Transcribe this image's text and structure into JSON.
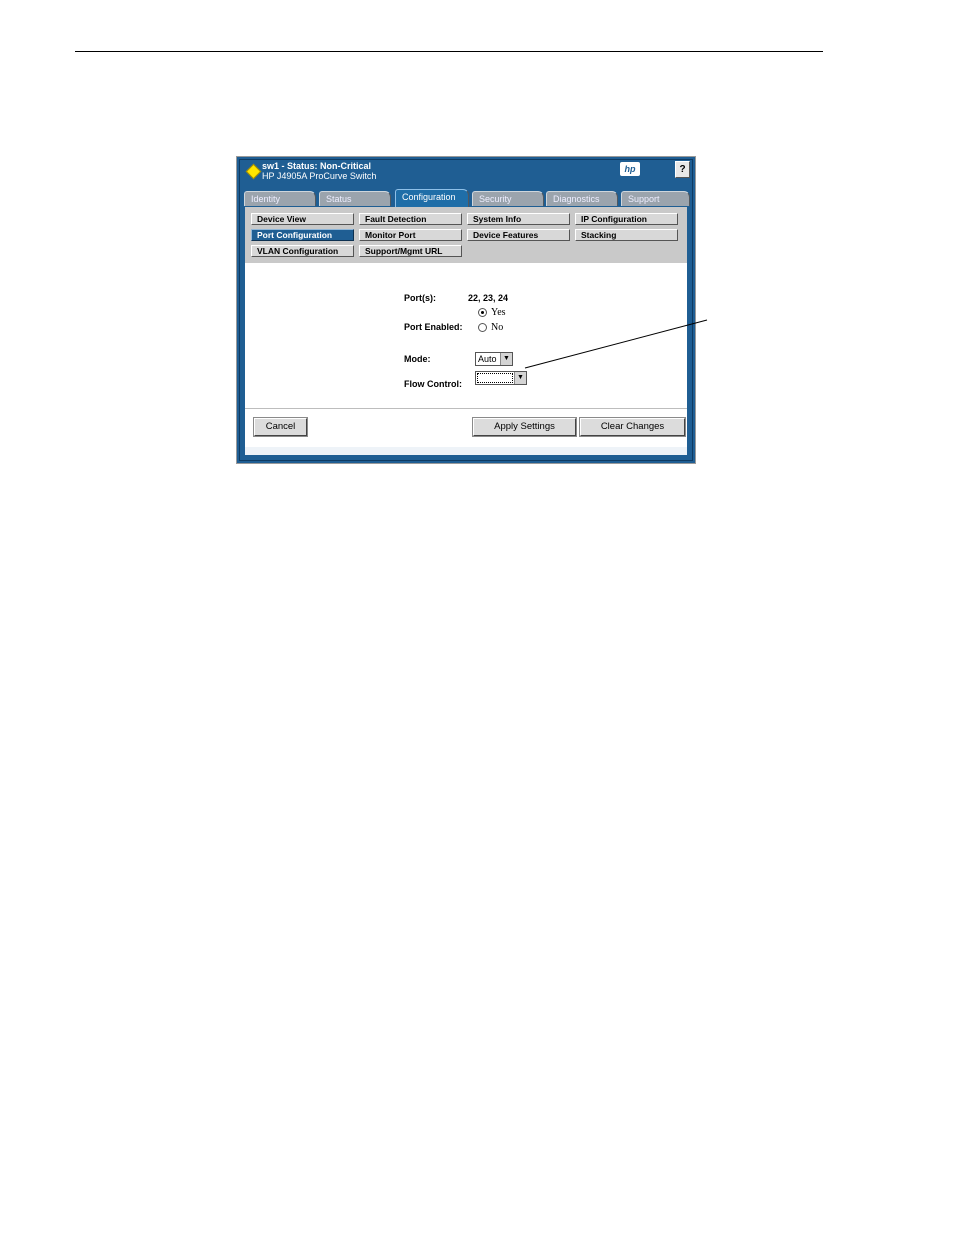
{
  "header": {
    "title": "sw1 - Status: Non-Critical",
    "subtitle": "HP J4905A ProCurve Switch",
    "logo_text": "hp",
    "help_label": "?",
    "status_color": "#ffe600"
  },
  "tabs": [
    {
      "label": "Identity"
    },
    {
      "label": "Status"
    },
    {
      "label": "Configuration"
    },
    {
      "label": "Security"
    },
    {
      "label": "Diagnostics"
    },
    {
      "label": "Support"
    }
  ],
  "active_tab": "Configuration",
  "subnav": [
    {
      "label": "Device View"
    },
    {
      "label": "Fault Detection"
    },
    {
      "label": "System Info"
    },
    {
      "label": "IP Configuration"
    },
    {
      "label": "Port Configuration"
    },
    {
      "label": "Monitor Port"
    },
    {
      "label": "Device Features"
    },
    {
      "label": "Stacking"
    },
    {
      "label": "VLAN Configuration"
    },
    {
      "label": "Support/Mgmt URL"
    }
  ],
  "active_subnav": "Port Configuration",
  "form": {
    "ports_label": "Port(s):",
    "ports_value": "22, 23, 24",
    "port_enabled_label": "Port Enabled:",
    "yes_label": "Yes",
    "no_label": "No",
    "port_enabled_value": "Yes",
    "mode_label": "Mode:",
    "mode_value": "Auto",
    "flow_control_label": "Flow Control:",
    "flow_control_value": ""
  },
  "buttons": {
    "cancel": "Cancel",
    "apply": "Apply Settings",
    "clear": "Clear Changes"
  },
  "colors": {
    "frame": "#1f5e93",
    "active_tab": "#1f6ea8"
  }
}
